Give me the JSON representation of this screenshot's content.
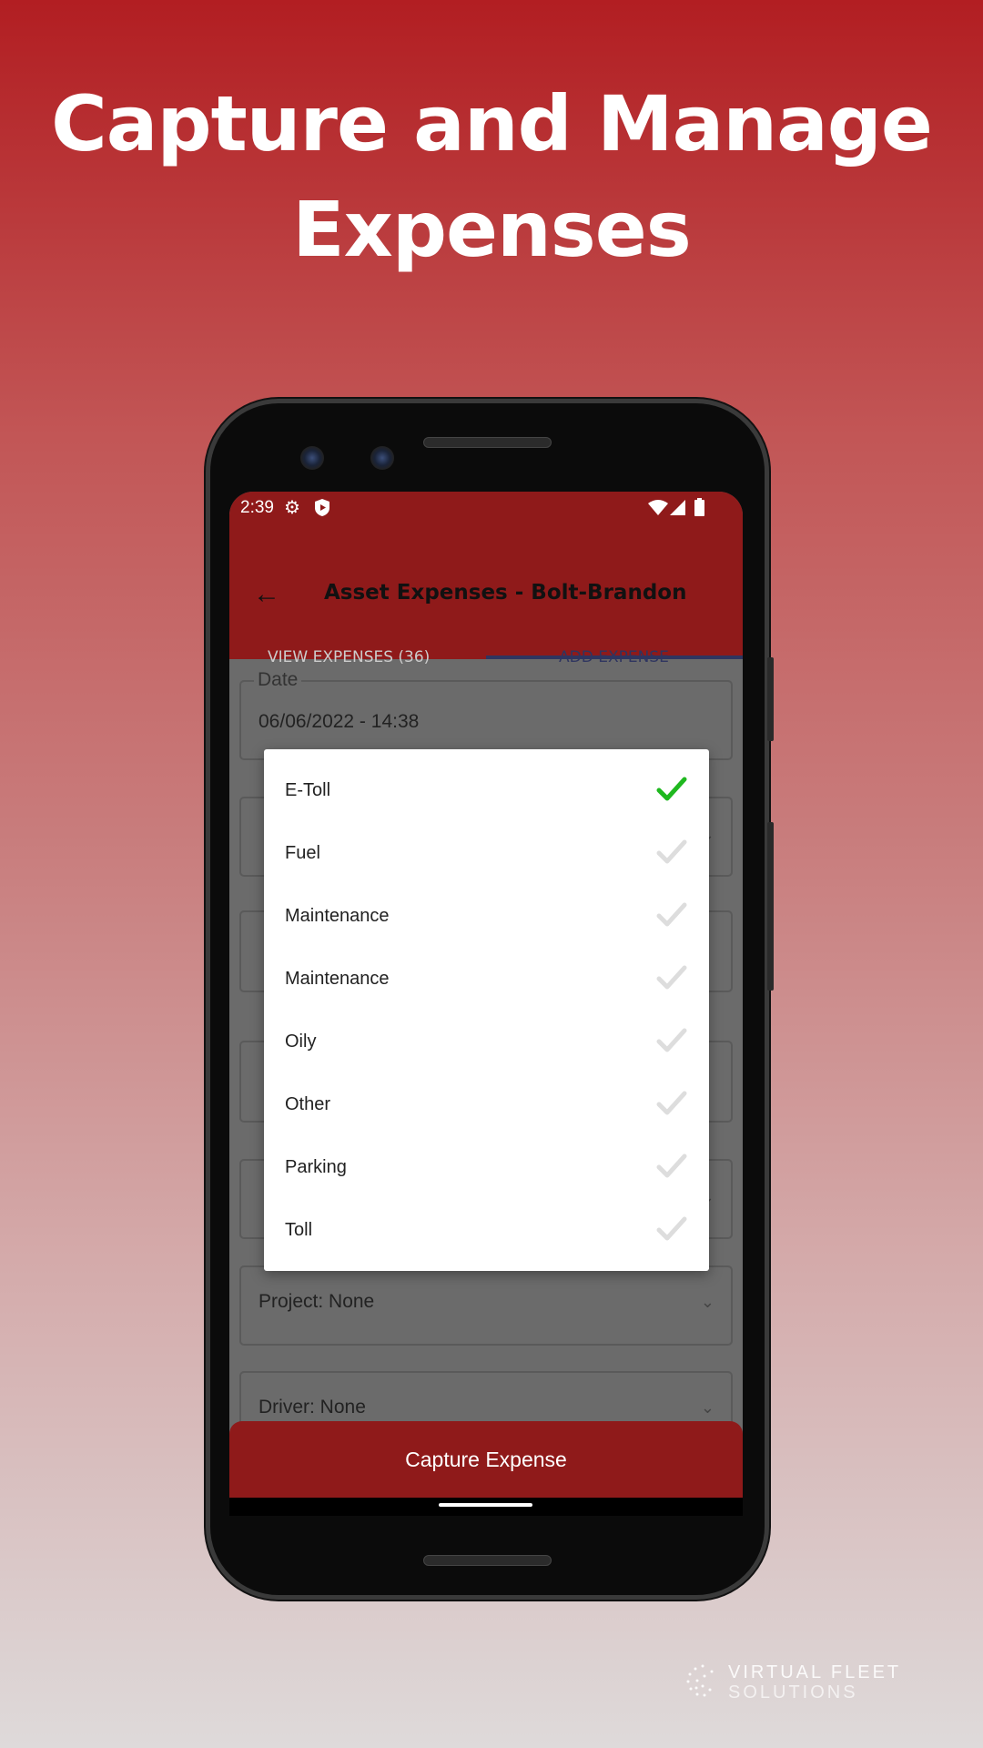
{
  "headline": {
    "line1": "Capture and Manage",
    "line2": "Expenses"
  },
  "status_bar": {
    "time": "2:39",
    "icons": [
      "gear-icon",
      "shield-play-icon",
      "wifi-icon",
      "signal-icon",
      "battery-icon"
    ]
  },
  "app_bar": {
    "title": "Asset Expenses - Bolt-Brandon",
    "back_icon": "arrow-left-icon"
  },
  "tabs": [
    {
      "label": "VIEW EXPENSES (36)",
      "active": false
    },
    {
      "label": "ADD EXPENSE",
      "active": true
    }
  ],
  "form": {
    "date": {
      "label": "Date",
      "value": "06/06/2022 - 14:38"
    },
    "project": {
      "value": "Project: None"
    },
    "driver": {
      "value": "Driver: None"
    }
  },
  "dialog": {
    "items": [
      {
        "label": "E-Toll",
        "selected": true
      },
      {
        "label": "Fuel",
        "selected": false
      },
      {
        "label": "Maintenance",
        "selected": false
      },
      {
        "label": "Maintenance",
        "selected": false
      },
      {
        "label": "Oily",
        "selected": false
      },
      {
        "label": "Other",
        "selected": false
      },
      {
        "label": "Parking",
        "selected": false
      },
      {
        "label": "Toll",
        "selected": false
      }
    ]
  },
  "capture_button": "Capture Expense",
  "brand": {
    "line1": "VIRTUAL FLEET",
    "line2": "SOLUTIONS"
  },
  "colors": {
    "brand_red": "#8f1a1a",
    "check_green": "#1fb81f",
    "check_gray": "#dddddd"
  }
}
